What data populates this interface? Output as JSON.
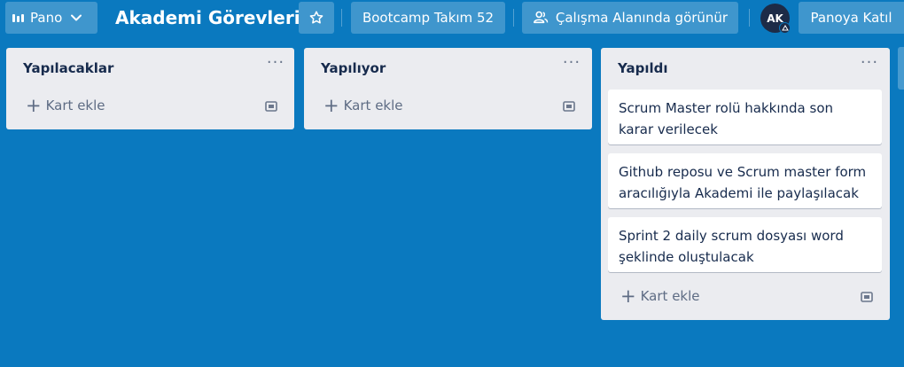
{
  "header": {
    "board_switcher_label": "Pano",
    "board_title": "Akademi Görevleri",
    "team_label": "Bootcamp Takım 52",
    "visibility_label": "Çalışma Alanında görünür",
    "avatar_initials": "AK",
    "join_label": "Panoya Katıl"
  },
  "lists": [
    {
      "title": "Yapılacaklar",
      "menu": "···",
      "cards": [],
      "add_card_label": "Kart ekle"
    },
    {
      "title": "Yapılıyor",
      "menu": "···",
      "cards": [],
      "add_card_label": "Kart ekle"
    },
    {
      "title": "Yapıldı",
      "menu": "···",
      "cards": [
        "Scrum Master rolü hakkında son karar verilecek",
        "Github reposu ve Scrum master form aracılığıyla Akademi ile paylaşılacak",
        "Sprint 2 daily scrum dosyası word şeklinde oluştulacak"
      ],
      "add_card_label": "Kart ekle"
    }
  ],
  "icons": {
    "board": "board-icon",
    "chevron": "chevron-down-icon",
    "star": "star-icon",
    "visibility": "people-icon",
    "template": "card-template-icon",
    "add": "plus-icon"
  },
  "colors": {
    "background": "#0a79bf",
    "list_bg": "#ebecf0",
    "card_bg": "#ffffff",
    "text": "#172b4d"
  }
}
